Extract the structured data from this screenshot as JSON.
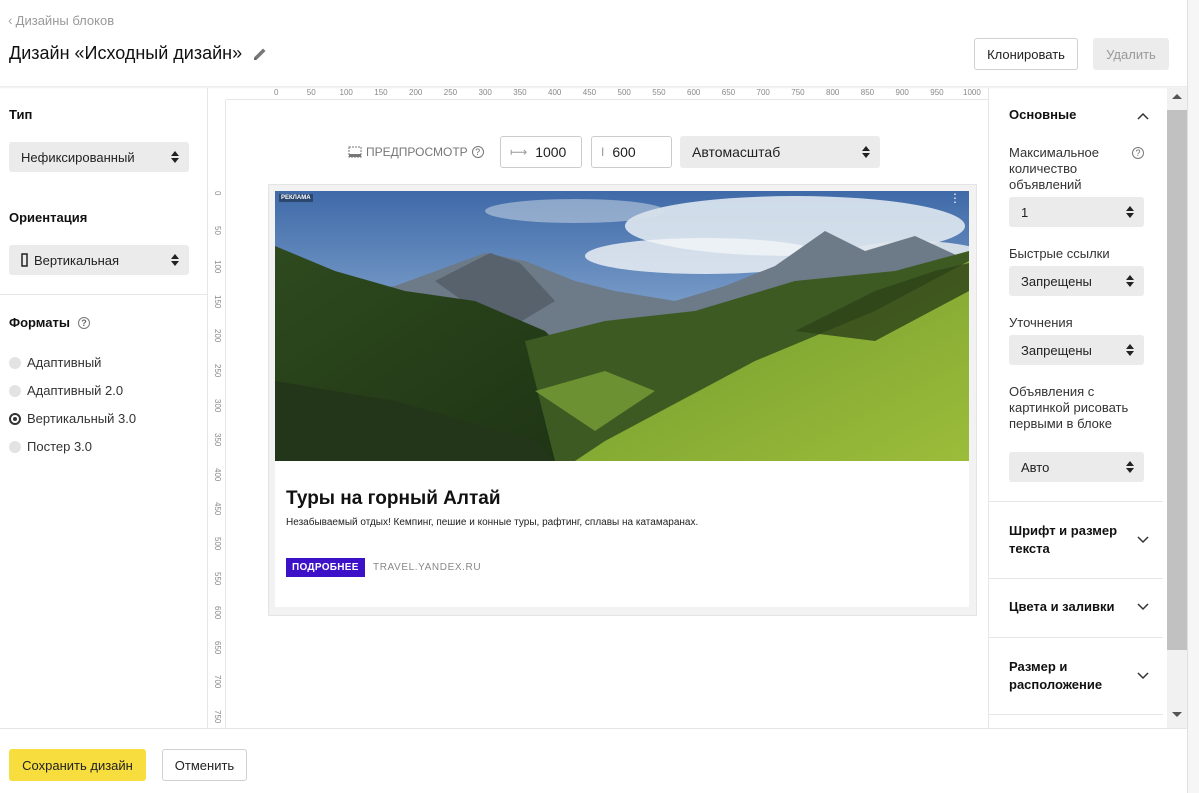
{
  "header": {
    "breadcrumb": "Дизайны блоков",
    "title": "Дизайн  «Исходный дизайн»",
    "clone_label": "Клонировать",
    "delete_label": "Удалить"
  },
  "left": {
    "type_label": "Тип",
    "type_value": "Нефиксированный",
    "orientation_label": "Ориентация",
    "orientation_value": "Вертикальная",
    "formats_label": "Форматы",
    "formats": [
      "Адаптивный",
      "Адаптивный 2.0",
      "Вертикальный 3.0",
      "Постер 3.0"
    ],
    "selected_format": "Вертикальный 3.0"
  },
  "rulers": {
    "top": [
      "0",
      "50",
      "100",
      "150",
      "200",
      "250",
      "300",
      "350",
      "400",
      "450",
      "500",
      "550",
      "600",
      "650",
      "700",
      "750",
      "800",
      "850",
      "900",
      "950",
      "1000"
    ],
    "left": [
      "0",
      "50",
      "100",
      "150",
      "200",
      "250",
      "300",
      "350",
      "400",
      "450",
      "500",
      "550",
      "600",
      "650",
      "700",
      "750"
    ]
  },
  "preview": {
    "label": "ПРЕДПРОСМОТР",
    "width": "1000",
    "height": "600",
    "zoom": "Автомасштаб"
  },
  "ad": {
    "badge": "РЕКЛАМА",
    "title": "Туры на горный Алтай",
    "text": "Незабываемый отдых! Кемпинг, пешие и конные туры, рафтинг, сплавы на катамаранах.",
    "cta": "ПОДРОБНЕЕ",
    "domain": "TRAVEL.YANDEX.RU"
  },
  "right": {
    "section_main": "Основные",
    "max_ads_label": "Максимальное количество объявлений",
    "max_ads_value": "1",
    "quick_links_label": "Быстрые ссылки",
    "quick_links_value": "Запрещены",
    "refinements_label": "Уточнения",
    "refinements_value": "Запрещены",
    "image_first_label": "Объявления с картинкой рисовать первыми в блоке",
    "image_first_value": "Авто",
    "section_font": "Шрифт и размер текста",
    "section_colors": "Цвета и заливки",
    "section_size": "Размер и расположение"
  },
  "footer": {
    "save_label": "Сохранить дизайн",
    "cancel_label": "Отменить"
  },
  "colors": {
    "save_button": "#f7dd3e",
    "cta_button": "#3d11c8"
  }
}
